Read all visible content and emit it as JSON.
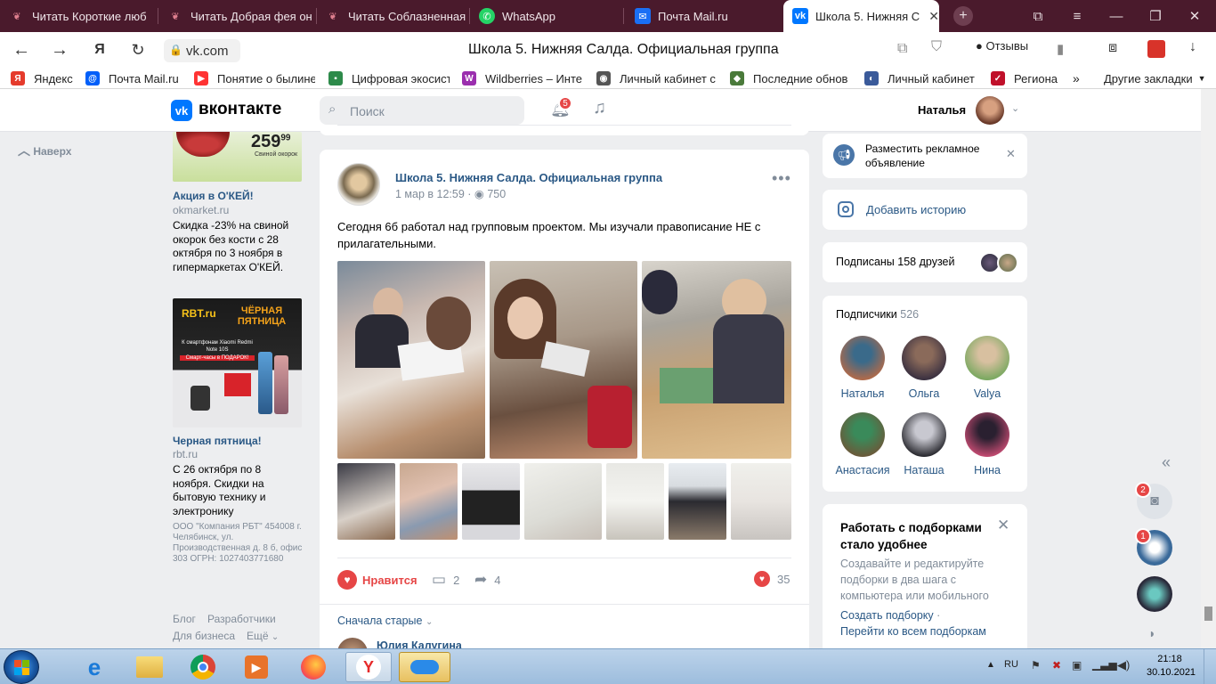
{
  "browser": {
    "tabs": [
      {
        "title": "Читать Короткие люб",
        "icon": "book-icon"
      },
      {
        "title": "Читать Добрая фея он",
        "icon": "book-icon"
      },
      {
        "title": "Читать Соблазненная",
        "icon": "book-icon"
      },
      {
        "title": "WhatsApp",
        "icon": "whatsapp-icon"
      },
      {
        "title": "Почта Mail.ru",
        "icon": "mail-icon"
      },
      {
        "title": "Школа 5. Нижняя С",
        "icon": "vk-icon"
      }
    ],
    "url": "vk.com",
    "page_title": "Школа 5. Нижняя Салда. Официальная группа",
    "reviews_label": "Отзывы",
    "bookmarks": [
      {
        "label": "Яндекс",
        "color": "#e53b2c",
        "glyph": "Я"
      },
      {
        "label": "Почта Mail.ru",
        "color": "#005ff9",
        "glyph": "@"
      },
      {
        "label": "Понятие о былине",
        "color": "#ff3333",
        "glyph": "▶"
      },
      {
        "label": "Цифровая экосист",
        "color": "#2d8a4a",
        "glyph": "▪"
      },
      {
        "label": "Wildberries – Инте",
        "color": "#9b2fae",
        "glyph": "W"
      },
      {
        "label": "Личный кабинет с",
        "color": "#555555",
        "glyph": "◉"
      },
      {
        "label": "Последние обнов",
        "color": "#4a7a3a",
        "glyph": "◆"
      },
      {
        "label": "Личный кабинет",
        "color": "#3a5a9a",
        "glyph": "◐"
      },
      {
        "label": "Региона",
        "color": "#c0102a",
        "glyph": "✓"
      }
    ],
    "more_bookmarks": "Другие закладки"
  },
  "vk": {
    "logo_text": "вконтакте",
    "search_placeholder": "Поиск",
    "notifications_count": "5",
    "user_name": "Наталья"
  },
  "left": {
    "back_to_top": "Наверх",
    "ad1": {
      "price": "259",
      "price_cents": "99",
      "caption": "Свиной окорок",
      "title": "Акция в О'КЕЙ!",
      "domain": "okmarket.ru",
      "text": "Скидка -23% на свиной окорок без кости с 28 октября по 3 ноября в гипермаркетах О'КЕЙ."
    },
    "ad2": {
      "brand": "RBT.ru",
      "banner_title": "ЧЁРНАЯ ПЯТНИЦА",
      "banner_text": "К смартфонам Xiaomi Redmi Note 10S",
      "banner_gift": "Смарт-часы в ПОДАРОК!",
      "title": "Черная пятница!",
      "domain": "rbt.ru",
      "text": "С 26 октября по 8 ноября. Скидки на бытовую технику и электронику",
      "legal": "ООО \"Компания РБТ\" 454008 г. Челябинск, ул. Производственная д. 8 б, офис 303 ОГРН: 1027403771680"
    },
    "footer": {
      "blog": "Блог",
      "developers": "Разработчики",
      "business": "Для бизнеса",
      "more": "Ещё"
    }
  },
  "post": {
    "author": "Школа 5. Нижняя Салда. Официальная группа",
    "date": "1 мар в 12:59",
    "views": "750",
    "text": "Сегодня 6б работал над групповым проектом. Мы изучали правописание НЕ с прилагательными.",
    "like_label": "Нравится",
    "comments": "2",
    "shares": "4",
    "likes": "35",
    "sort_label": "Сначала старые",
    "commenter": "Юлия Калугина"
  },
  "right": {
    "ad_action": "Разместить рекламное объявление",
    "add_story": "Добавить историю",
    "friends_subscribed": "Подписаны 158 друзей",
    "subscribers_label": "Подписчики",
    "subscribers_count": "526",
    "subscribers": [
      {
        "name": "Наталья",
        "c1": "#b06a4a",
        "c2": "#3a6a8a"
      },
      {
        "name": "Ольга",
        "c1": "#3a3040",
        "c2": "#8a6a5a"
      },
      {
        "name": "Valya",
        "c1": "#7aa860",
        "c2": "#d8c0a0"
      },
      {
        "name": "Анастасия",
        "c1": "#6a5a3a",
        "c2": "#3a8a5a"
      },
      {
        "name": "Наташа",
        "c1": "#2a2a30",
        "c2": "#c8c8d0"
      },
      {
        "name": "Нина",
        "c1": "#c04a70",
        "c2": "#2a2030"
      }
    ],
    "promo_title": "Работать с подборками стало удобнее",
    "promo_text": "Создавайте и редактируйте подборки в два шага с компьютера или мобильного",
    "promo_link1": "Создать подборку",
    "promo_link2": "Перейти ко всем подборкам"
  },
  "side_bubbles": {
    "badge1": "2",
    "badge2": "1"
  },
  "taskbar": {
    "lang": "RU",
    "time": "21:18",
    "date": "30.10.2021"
  }
}
